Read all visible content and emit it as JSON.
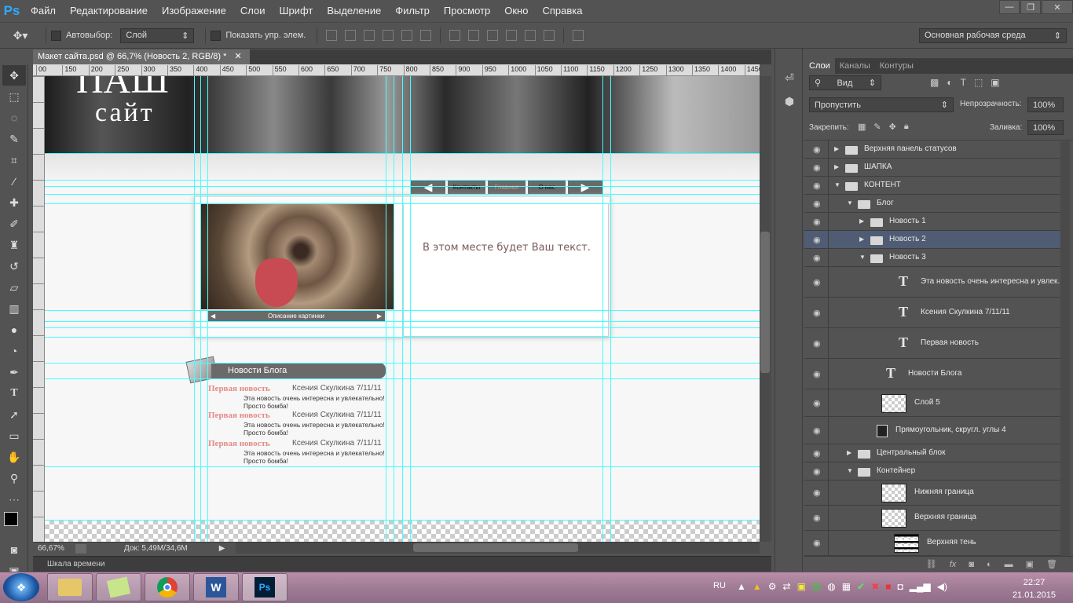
{
  "app": {
    "name": "Ps",
    "accent": "#31a8ff"
  },
  "menu": [
    "Файл",
    "Редактирование",
    "Изображение",
    "Слои",
    "Шрифт",
    "Выделение",
    "Фильтр",
    "Просмотр",
    "Окно",
    "Справка"
  ],
  "window_controls": {
    "minimize": "—",
    "restore": "❐",
    "close": "✕"
  },
  "options": {
    "autoselect_label": "Автовыбор:",
    "autoselect_value": "Слой",
    "show_controls_label": "Показать упр. элем.",
    "workspace": "Основная рабочая среда"
  },
  "document_tab": {
    "title": "Макет сайта.psd @ 66,7% (Новость 2, RGB/8) *"
  },
  "ruler_h": [
    "00",
    "150",
    "200",
    "250",
    "300",
    "350",
    "400",
    "450",
    "500",
    "550",
    "600",
    "650",
    "700",
    "750",
    "800",
    "850",
    "900",
    "950",
    "1000",
    "1050",
    "1100",
    "1150",
    "1200",
    "1250",
    "1300",
    "1350",
    "1400",
    "1450"
  ],
  "canvas": {
    "header_title1": "ПАШ",
    "header_title2": "сайт",
    "nav_items": [
      "Контакты",
      "Главная",
      "О нас"
    ],
    "nav_active_color": "#d98c7a",
    "photo_caption": "Описание картинки",
    "text_panel": "В этом месте будет Ваш текст.",
    "blog_header": "Новости Блога",
    "news": [
      {
        "title": "Первая новость",
        "meta": "Ксения Скулкина   7/11/11",
        "body": "Эта новость очень интересна и увлекательно! Просто бомба!"
      },
      {
        "title": "Первая новость",
        "meta": "Ксения Скулкина   7/11/11",
        "body": "Эта новость очень интересна и увлекательно! Просто бомба!"
      },
      {
        "title": "Первая новость",
        "meta": "Ксения Скулкина   7/11/11",
        "body": "Эта новость очень интересна и увлекательно! Просто бомба!"
      }
    ],
    "guide_color": "#44ffff"
  },
  "status": {
    "zoom": "66,67%",
    "doc": "Док: 5,49M/34,6M"
  },
  "timeline_label": "Шкала времени",
  "layers_panel": {
    "tabs": [
      "Слои",
      "Каналы",
      "Контуры"
    ],
    "filter": "Вид",
    "blend": "Пропустить",
    "opacity_label": "Непрозрачность:",
    "opacity": "100%",
    "lock_label": "Закрепить:",
    "fill_label": "Заливка:",
    "fill": "100%",
    "layers": [
      {
        "name": "Верхняя панель статусов",
        "kind": "folder",
        "expanded": false
      },
      {
        "name": "ШАПКА",
        "kind": "folder",
        "expanded": false
      },
      {
        "name": "КОНТЕНТ",
        "kind": "folder",
        "expanded": true
      },
      {
        "name": "Блог",
        "kind": "folder",
        "expanded": true
      },
      {
        "name": "Новость 1",
        "kind": "folder",
        "expanded": false
      },
      {
        "name": "Новость 2",
        "kind": "folder",
        "expanded": false,
        "selected": true
      },
      {
        "name": "Новость 3",
        "kind": "folder",
        "expanded": true
      },
      {
        "name": "Эта новость очень интересна и увлек...",
        "kind": "text"
      },
      {
        "name": "Ксения Скулкина   7/11/11",
        "kind": "text"
      },
      {
        "name": "Первая новость",
        "kind": "text"
      },
      {
        "name": "Новости Блога",
        "kind": "text"
      },
      {
        "name": "Слой 5",
        "kind": "pixel"
      },
      {
        "name": "Прямоугольник, скругл. углы 4",
        "kind": "shape"
      },
      {
        "name": "Центральный блок",
        "kind": "folder",
        "expanded": false
      },
      {
        "name": "Контейнер",
        "kind": "folder",
        "expanded": true
      },
      {
        "name": "Нижняя граница",
        "kind": "pixel"
      },
      {
        "name": "Верхняя граница",
        "kind": "pixel"
      },
      {
        "name": "Верхняя тень",
        "kind": "pixel"
      }
    ],
    "selected_color": "#4f5c73"
  },
  "taskbar": {
    "lang": "RU",
    "time": "22:27",
    "date": "21.01.2015",
    "apps": [
      "file-explorer-icon",
      "sticky-notes-icon",
      "chrome-icon",
      "word-icon",
      "photoshop-icon"
    ],
    "photoshop_label": "Ps",
    "word_label": "W"
  }
}
